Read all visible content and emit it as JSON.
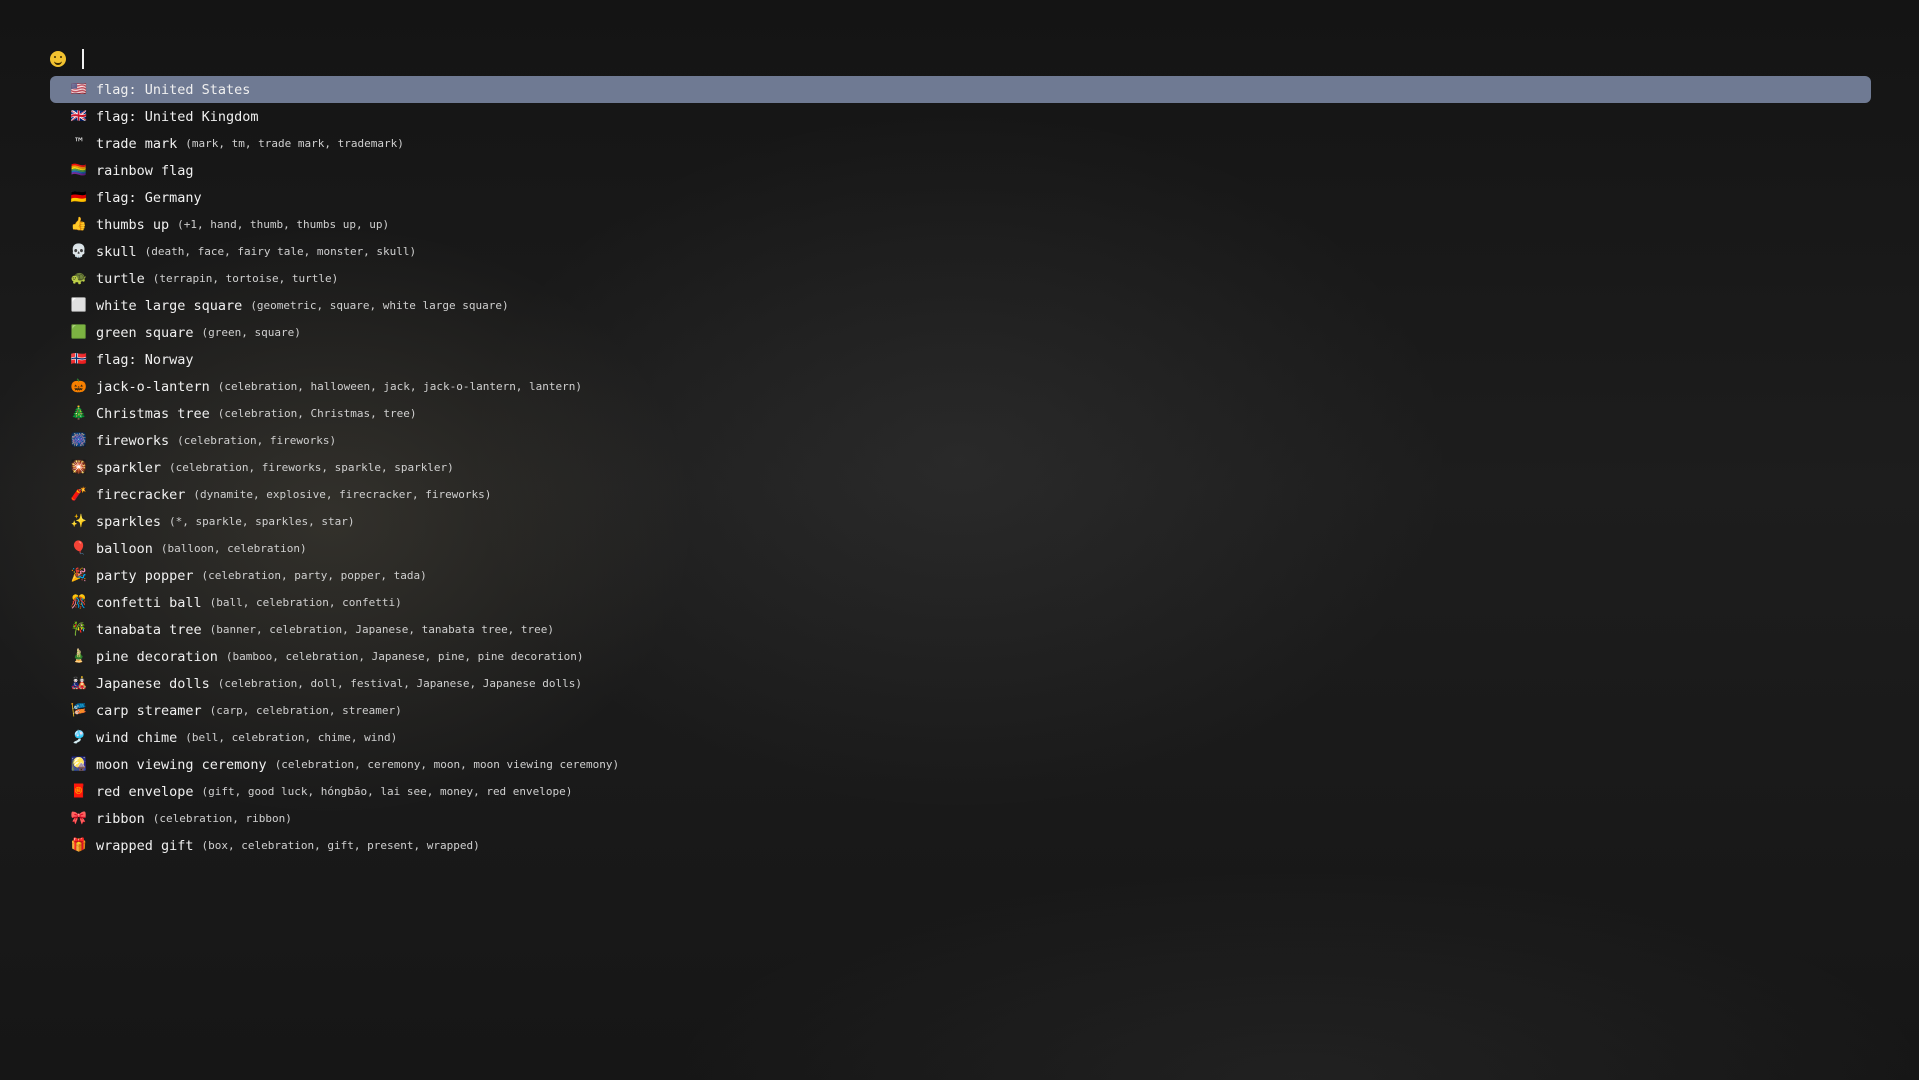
{
  "search": {
    "icon": "smiley-icon",
    "value": "",
    "placeholder": ""
  },
  "colors": {
    "selection": "#6f7a93",
    "background": "#1a1a1a",
    "text": "#f0f0f0"
  },
  "results": [
    {
      "emoji": "🇺🇸",
      "name": "flag: United States",
      "keywords": "",
      "selected": true
    },
    {
      "emoji": "🇬🇧",
      "name": "flag: United Kingdom",
      "keywords": ""
    },
    {
      "emoji": "™",
      "name": "trade mark",
      "keywords": "(mark, tm, trade mark, trademark)"
    },
    {
      "emoji": "🏳️‍🌈",
      "name": "rainbow flag",
      "keywords": ""
    },
    {
      "emoji": "🇩🇪",
      "name": "flag: Germany",
      "keywords": ""
    },
    {
      "emoji": "👍",
      "name": "thumbs up",
      "keywords": "(+1, hand, thumb, thumbs up, up)"
    },
    {
      "emoji": "💀",
      "name": "skull",
      "keywords": "(death, face, fairy tale, monster, skull)"
    },
    {
      "emoji": "🐢",
      "name": "turtle",
      "keywords": "(terrapin, tortoise, turtle)"
    },
    {
      "emoji": "⬜",
      "name": "white large square",
      "keywords": "(geometric, square, white large square)"
    },
    {
      "emoji": "🟩",
      "name": "green square",
      "keywords": "(green, square)"
    },
    {
      "emoji": "🇳🇴",
      "name": "flag: Norway",
      "keywords": ""
    },
    {
      "emoji": "🎃",
      "name": "jack-o-lantern",
      "keywords": "(celebration, halloween, jack, jack-o-lantern, lantern)"
    },
    {
      "emoji": "🎄",
      "name": "Christmas tree",
      "keywords": "(celebration, Christmas, tree)"
    },
    {
      "emoji": "🎆",
      "name": "fireworks",
      "keywords": "(celebration, fireworks)"
    },
    {
      "emoji": "🎇",
      "name": "sparkler",
      "keywords": "(celebration, fireworks, sparkle, sparkler)"
    },
    {
      "emoji": "🧨",
      "name": "firecracker",
      "keywords": "(dynamite, explosive, firecracker, fireworks)"
    },
    {
      "emoji": "✨",
      "name": "sparkles",
      "keywords": "(*, sparkle, sparkles, star)"
    },
    {
      "emoji": "🎈",
      "name": "balloon",
      "keywords": "(balloon, celebration)"
    },
    {
      "emoji": "🎉",
      "name": "party popper",
      "keywords": "(celebration, party, popper, tada)"
    },
    {
      "emoji": "🎊",
      "name": "confetti ball",
      "keywords": "(ball, celebration, confetti)"
    },
    {
      "emoji": "🎋",
      "name": "tanabata tree",
      "keywords": "(banner, celebration, Japanese, tanabata tree, tree)"
    },
    {
      "emoji": "🎍",
      "name": "pine decoration",
      "keywords": "(bamboo, celebration, Japanese, pine, pine decoration)"
    },
    {
      "emoji": "🎎",
      "name": "Japanese dolls",
      "keywords": "(celebration, doll, festival, Japanese, Japanese dolls)"
    },
    {
      "emoji": "🎏",
      "name": "carp streamer",
      "keywords": "(carp, celebration, streamer)"
    },
    {
      "emoji": "🎐",
      "name": "wind chime",
      "keywords": "(bell, celebration, chime, wind)"
    },
    {
      "emoji": "🎑",
      "name": "moon viewing ceremony",
      "keywords": "(celebration, ceremony, moon, moon viewing ceremony)"
    },
    {
      "emoji": "🧧",
      "name": "red envelope",
      "keywords": "(gift, good luck, hóngbāo, lai see, money, red envelope)"
    },
    {
      "emoji": "🎀",
      "name": "ribbon",
      "keywords": "(celebration, ribbon)"
    },
    {
      "emoji": "🎁",
      "name": "wrapped gift",
      "keywords": "(box, celebration, gift, present, wrapped)"
    }
  ]
}
